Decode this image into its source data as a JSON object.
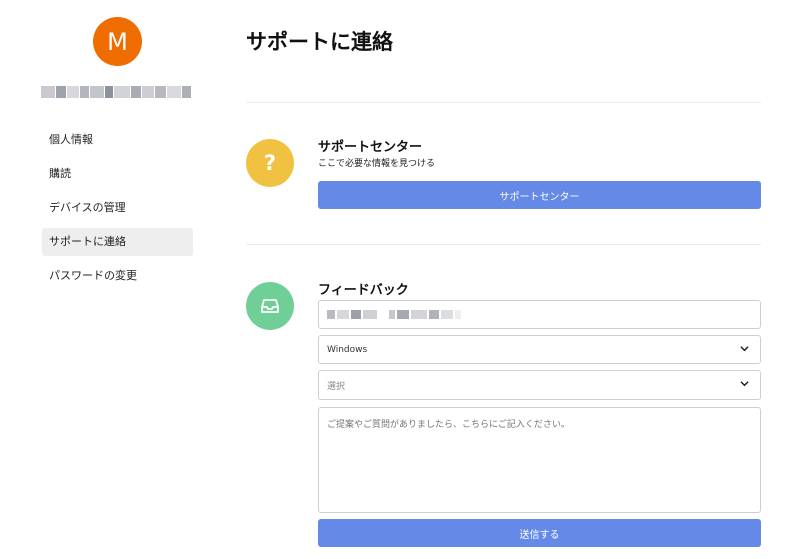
{
  "profile": {
    "avatar_initial": "M"
  },
  "sidebar": {
    "items": [
      {
        "label": "個人情報",
        "active": false
      },
      {
        "label": "購読",
        "active": false
      },
      {
        "label": "デバイスの管理",
        "active": false
      },
      {
        "label": "サポートに連絡",
        "active": true
      },
      {
        "label": "パスワードの変更",
        "active": false
      }
    ]
  },
  "main": {
    "title": "サポートに連絡",
    "support_center": {
      "title": "サポートセンター",
      "description": "ここで必要な情報を見つける",
      "button_label": "サポートセンター",
      "icon": "question-icon"
    },
    "feedback": {
      "title": "フィードバック",
      "icon": "inbox-icon",
      "os_select_value": "Windows",
      "category_select_placeholder": "選択",
      "message_placeholder": "ご提案やご質問がありましたら、こちらにご記入ください。",
      "submit_label": "送信する"
    }
  },
  "colors": {
    "avatar": "#ef6c00",
    "help_icon": "#f1c242",
    "feedback_icon": "#6fcf97",
    "primary_button": "#6589e6"
  }
}
